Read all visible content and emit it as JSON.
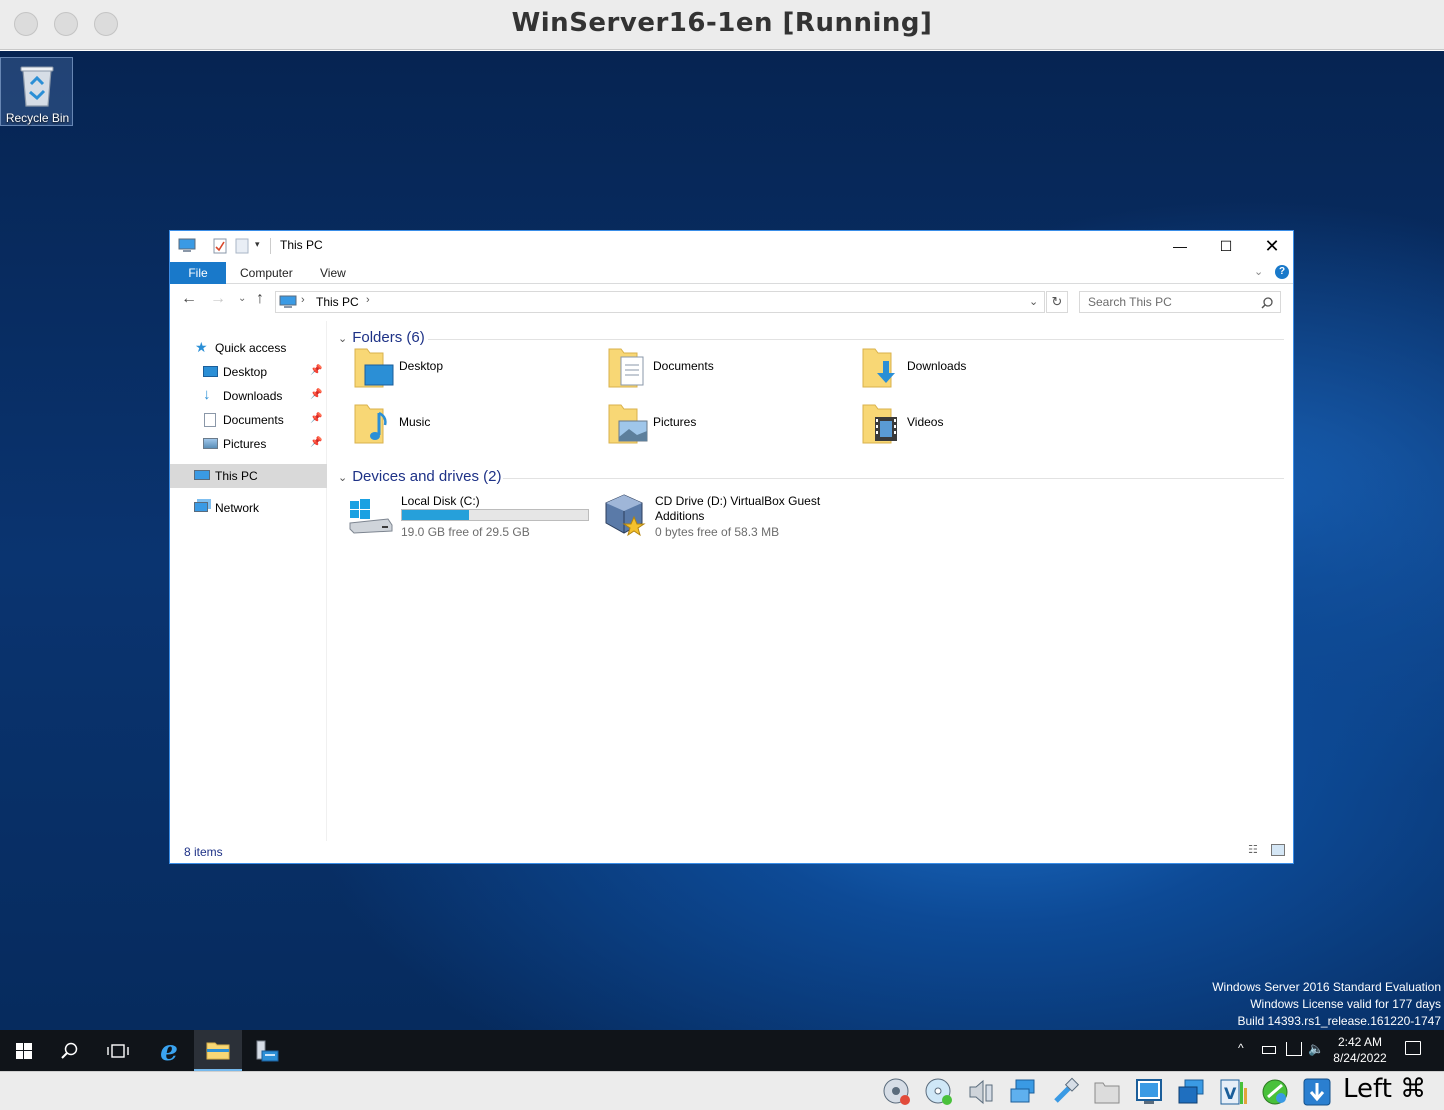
{
  "host": {
    "title": "WinServer16-1en [Running]",
    "host_key": "Left ⌘"
  },
  "desktop": {
    "recycle_bin_label": "Recycle Bin",
    "watermark": {
      "line1": "Windows Server 2016 Standard Evaluation",
      "line2": "Windows License valid for 177 days",
      "line3": "Build 14393.rs1_release.161220-1747"
    }
  },
  "explorer": {
    "title": "This PC",
    "ribbon_tabs": [
      "File",
      "Computer",
      "View"
    ],
    "address": "This PC",
    "search_placeholder": "Search This PC",
    "nav": {
      "quick_access": "Quick access",
      "quick_items": [
        "Desktop",
        "Downloads",
        "Documents",
        "Pictures"
      ],
      "this_pc": "This PC",
      "network": "Network"
    },
    "folders_header": "Folders (6)",
    "folders": [
      "Desktop",
      "Documents",
      "Downloads",
      "Music",
      "Pictures",
      "Videos"
    ],
    "drives_header": "Devices and drives (2)",
    "drives": [
      {
        "name": "Local Disk (C:)",
        "free": "19.0 GB free of 29.5 GB",
        "used_fraction": 0.36
      },
      {
        "name_line1": "CD Drive (D:) VirtualBox Guest",
        "name_line2": "Additions",
        "free": "0 bytes free of 58.3 MB"
      }
    ],
    "status": "8 items"
  },
  "taskbar": {
    "time": "2:42 AM",
    "date": "8/24/2022"
  },
  "colors": {
    "accent": "#1979ca",
    "progress": "#26a0da",
    "folder": "#f8d775"
  }
}
